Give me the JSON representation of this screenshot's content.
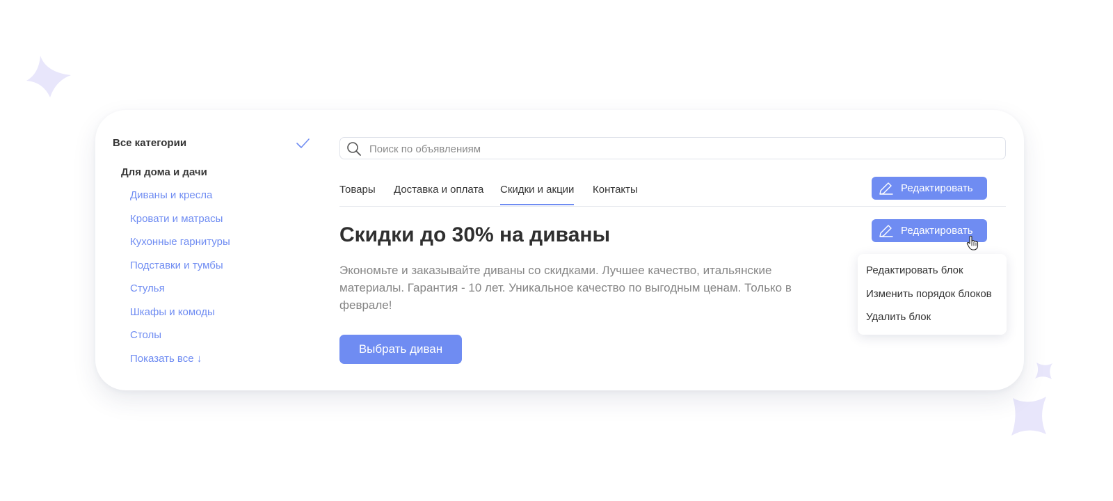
{
  "sidebar": {
    "all_categories": "Все категории",
    "group": "Для дома и дачи",
    "items": [
      "Диваны и кресла",
      "Кровати и матрасы",
      "Кухонные гарнитуры",
      "Подставки и тумбы",
      "Стулья",
      "Шкафы и комоды",
      "Столы",
      "Показать все ↓"
    ]
  },
  "search": {
    "placeholder": "Поиск по объявлениям",
    "value": ""
  },
  "tabs": [
    "Товары",
    "Доставка и оплата",
    "Скидки и акции",
    "Контакты"
  ],
  "active_tab": "Скидки и акции",
  "edit_label": "Редактировать",
  "banner": {
    "title": "Скидки до 30% на диваны",
    "text": "Экономьте и заказывайте диваны со скидками. Лучшее качество, итальянские материалы. Гарантия - 10 лет. Уникальное качество по выгодным ценам. Только в феврале!",
    "button": "Выбрать диван"
  },
  "menu": [
    "Редактировать блок",
    "Изменить порядок блоков",
    "Удалить блок"
  ],
  "colors": {
    "accent": "#6f8cf2",
    "text": "#333333",
    "muted": "#858585",
    "sparkle": "#e8e6fb"
  },
  "icons": [
    "check-icon",
    "search-icon",
    "pencil-icon",
    "hand-cursor-icon",
    "sparkle-icon"
  ]
}
